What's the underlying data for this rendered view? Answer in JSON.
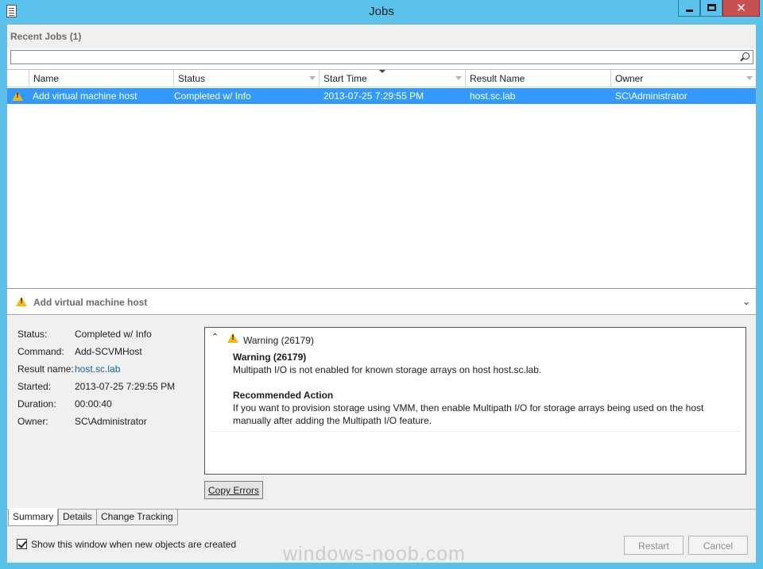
{
  "window": {
    "title": "Jobs",
    "close_glyph": "✕"
  },
  "recent": {
    "label": "Recent Jobs (1)"
  },
  "search": {
    "value": "",
    "placeholder": ""
  },
  "grid": {
    "columns": [
      "Name",
      "Status",
      "Start Time",
      "Result Name",
      "Owner"
    ],
    "sorted_column": "Start Time",
    "rows": [
      {
        "icon": "warning-icon",
        "name": "Add virtual machine host",
        "status": "Completed w/ Info",
        "start_time": "2013-07-25 7:29:55 PM",
        "result_name": "host.sc.lab",
        "owner": "SC\\Administrator",
        "selected": true
      }
    ]
  },
  "detail": {
    "title": "Add virtual machine host",
    "expand_glyph": "⌄",
    "properties": {
      "status_label": "Status:",
      "status": "Completed w/ Info",
      "command_label": "Command:",
      "command": "Add-SCVMHost",
      "result_label": "Result name:",
      "result": "host.sc.lab",
      "started_label": "Started:",
      "started": "2013-07-25 7:29:55 PM",
      "duration_label": "Duration:",
      "duration": "00:00:40",
      "owner_label": "Owner:",
      "owner": "SC\\Administrator"
    },
    "message": {
      "collapse_glyph": "⌃",
      "header": "Warning (26179)",
      "title": "Warning (26179)",
      "text": "Multipath I/O is not enabled for known storage arrays on host host.sc.lab.",
      "action_title": "Recommended Action",
      "action_line1": "If you want to provision storage using VMM, then enable Multipath I/O for storage arrays being used on the host",
      "action_line2": "manually after adding the Multipath I/O feature."
    },
    "copy_button": "Copy Errors"
  },
  "tabs": [
    "Summary",
    "Details",
    "Change Tracking"
  ],
  "active_tab": "Summary",
  "footer": {
    "checkbox_label": "Show this window when new objects are created",
    "checkbox_checked": true,
    "restart": "Restart",
    "cancel": "Cancel"
  },
  "watermark": "windows-noob.com",
  "colors": {
    "selection": "#3399ff",
    "titlebar": "#5cc3ec",
    "close": "#c75050",
    "warning": "#f2b816"
  }
}
